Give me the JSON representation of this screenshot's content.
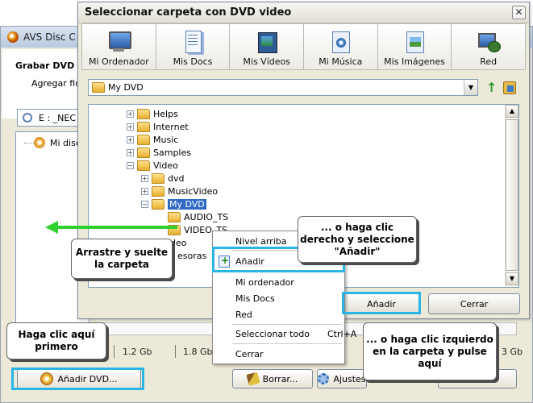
{
  "background_window": {
    "title": "AVS Disc C",
    "heading": "Grabar DVD e",
    "subheading": "Agregar fich",
    "drive_label": "E : _NEC",
    "tree_item": "Mi disco",
    "sizes": [
      "1.2 Gb",
      "1.8 Gb",
      "3 Gb"
    ],
    "buttons": {
      "add_dvd": "Añadir DVD...",
      "clear": "Borrar...",
      "settings": "Ajustes"
    }
  },
  "dialog": {
    "title": "Seleccionar carpeta con DVD video",
    "close_glyph": "✕",
    "places": [
      {
        "label": "Mi Ordenador",
        "icon": "computer-icon"
      },
      {
        "label": "Mis Docs",
        "icon": "documents-icon"
      },
      {
        "label": "Mis Vídeos",
        "icon": "videos-icon"
      },
      {
        "label": "Mi Música",
        "icon": "music-icon"
      },
      {
        "label": "Mis Imágenes",
        "icon": "images-icon"
      },
      {
        "label": "Red",
        "icon": "network-icon"
      }
    ],
    "path_value": "My DVD",
    "tree": [
      {
        "label": "Helps",
        "expander": "+"
      },
      {
        "label": "Internet",
        "expander": "+"
      },
      {
        "label": "Music",
        "expander": "+"
      },
      {
        "label": "Samples",
        "expander": "+"
      },
      {
        "label": "Video",
        "expander": "−"
      },
      {
        "label": "dvd",
        "expander": "+"
      },
      {
        "label": "MusicVideo",
        "expander": "+"
      },
      {
        "label": "My DVD",
        "expander": "−"
      },
      {
        "label": "AUDIO_TS",
        "expander": ""
      },
      {
        "label": "VIDEO_TS",
        "expander": ""
      },
      {
        "label": "ideo",
        "expander": ""
      },
      {
        "label": "esoras",
        "expander": ""
      }
    ],
    "buttons": {
      "add": "Añadir",
      "close": "Cerrar"
    }
  },
  "context_menu": {
    "items": [
      "Nivel arriba",
      "Añadir",
      "Mi ordenador",
      "Mis Docs",
      "Red",
      "Seleccionar todo",
      "Cerrar"
    ],
    "shortcut": "Ctrl+A"
  },
  "annotations": {
    "drag": "Arrastre y suelte la carpeta",
    "right_click": "... o haga clic derecho y seleccione \"Añadir\"",
    "click_first": "Haga clic aquí primero",
    "left_click": "... o haga clic izquierdo en la carpeta y pulse aquí"
  },
  "colors": {
    "highlight": "#29b6e6",
    "arrow": "#2fd12f",
    "selection": "#316ac5"
  }
}
